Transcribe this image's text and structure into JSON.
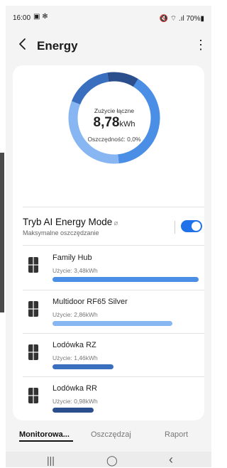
{
  "status_bar": {
    "time": "16:00",
    "left_icons": "▣ ✻",
    "right_text": "🔇 ⌔ .ıl 70%▮"
  },
  "app_bar": {
    "title": "Energy",
    "back_icon": "chevron-left-icon",
    "menu_icon": "⋮"
  },
  "summary": {
    "label": "Zużycie łączne",
    "value": "8,78",
    "unit": "kWh",
    "saving": "Oszczędność: 0,0%",
    "segments": [
      {
        "name": "Family Hub",
        "value": 3.48,
        "color": "#4a8ee6"
      },
      {
        "name": "Multidoor RF65 Silver",
        "value": 2.86,
        "color": "#87b6f2"
      },
      {
        "name": "Lodówka RZ",
        "value": 1.46,
        "color": "#3a6fbf"
      },
      {
        "name": "Lodówka RR",
        "value": 0.98,
        "color": "#2a4f8c"
      }
    ]
  },
  "ai_mode": {
    "title": "Tryb AI Energy Mode",
    "subtitle": "Maksymalne oszczędzanie",
    "enabled": true
  },
  "devices": [
    {
      "name": "Family Hub",
      "usage": "Użycie: 3,48kWh",
      "value": 3.48,
      "color": "#4a8ee6"
    },
    {
      "name": "Multidoor RF65 Silver",
      "usage": "Użycie: 2,86kWh",
      "value": 2.86,
      "color": "#87b6f2"
    },
    {
      "name": "Lodówka RZ",
      "usage": "Użycie: 1,46kWh",
      "value": 1.46,
      "color": "#3a6fbf"
    },
    {
      "name": "Lodówka RR",
      "usage": "Użycie: 0,98kWh",
      "value": 0.98,
      "color": "#2a4f8c"
    }
  ],
  "tabs": {
    "monitor": "Monitorowa...",
    "save": "Oszczędzaj",
    "report": "Raport"
  },
  "nav": {
    "recent": "|||",
    "home": "◯",
    "back": "‹"
  }
}
